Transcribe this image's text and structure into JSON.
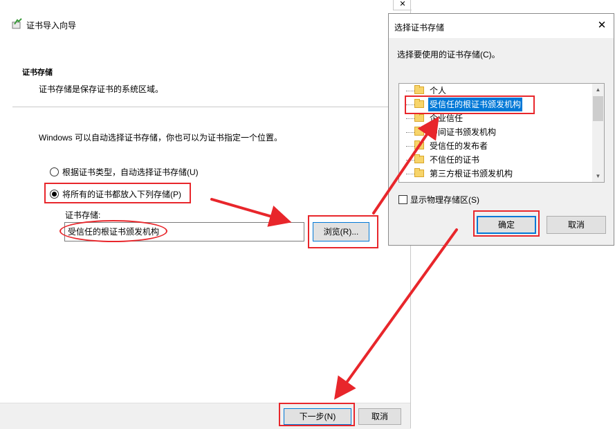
{
  "wizard": {
    "title": "证书导入向导",
    "close_glyph": "✕",
    "section_title": "证书存储",
    "section_desc": "证书存储是保存证书的系统区域。",
    "intro": "Windows 可以自动选择证书存储，你也可以为证书指定一个位置。",
    "radio_auto": "根据证书类型，自动选择证书存储(U)",
    "radio_manual": "将所有的证书都放入下列存储(P)",
    "selected_radio": "manual",
    "store_label": "证书存储:",
    "store_value": "受信任的根证书颁发机构",
    "browse_label": "浏览(R)...",
    "next_label": "下一步(N)",
    "cancel_label": "取消"
  },
  "dialog": {
    "title": "选择证书存储",
    "close_glyph": "✕",
    "prompt": "选择要使用的证书存储(C)。",
    "stores": [
      {
        "label": "个人",
        "selected": false
      },
      {
        "label": "受信任的根证书颁发机构",
        "selected": true
      },
      {
        "label": "企业信任",
        "selected": false
      },
      {
        "label": "中间证书颁发机构",
        "selected": false
      },
      {
        "label": "受信任的发布者",
        "selected": false
      },
      {
        "label": "不信任的证书",
        "selected": false
      },
      {
        "label": "第三方根证书颁发机构",
        "selected": false
      }
    ],
    "show_physical_label": "显示物理存储区(S)",
    "show_physical_checked": false,
    "ok_label": "确定",
    "cancel_label": "取消"
  },
  "colors": {
    "accent": "#0078d7",
    "annotation": "#e8262b",
    "folder": "#f7d46a"
  }
}
